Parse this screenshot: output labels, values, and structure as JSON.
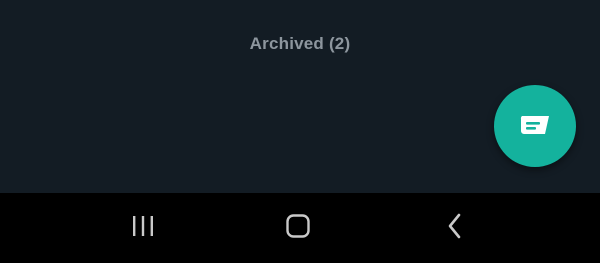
{
  "chat_list": {
    "archived_label": "Archived (2)"
  },
  "fab": {
    "icon": "new-chat-icon",
    "color": "#14b29d"
  },
  "system_nav": {
    "recents_icon": "recents-icon",
    "home_icon": "home-icon",
    "back_icon": "back-icon"
  }
}
